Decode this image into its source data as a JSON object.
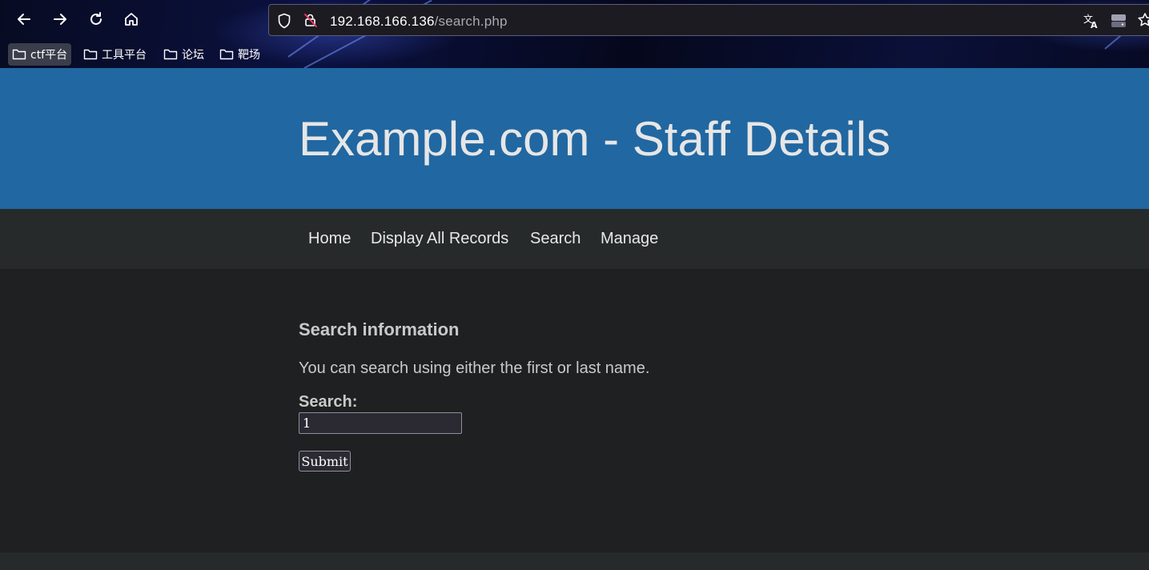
{
  "browser": {
    "url_host": "192.168.166.136",
    "url_path": "/search.php",
    "bookmarks": [
      {
        "label": "ctf平台"
      },
      {
        "label": "工具平台"
      },
      {
        "label": "论坛"
      },
      {
        "label": "靶场"
      }
    ]
  },
  "site": {
    "title": "Example.com - Staff Details"
  },
  "nav": {
    "items": [
      {
        "label": "Home"
      },
      {
        "label": "Display All Records"
      },
      {
        "label": "Search"
      },
      {
        "label": "Manage"
      }
    ]
  },
  "main": {
    "heading": "Search information",
    "description": "You can search using either the first or last name.",
    "search_label": "Search:",
    "search_value": "1",
    "submit_label": "Submit"
  },
  "colors": {
    "header_bg": "#2167a1",
    "navbar_bg": "#262a2b",
    "content_bg": "#1e2021"
  }
}
